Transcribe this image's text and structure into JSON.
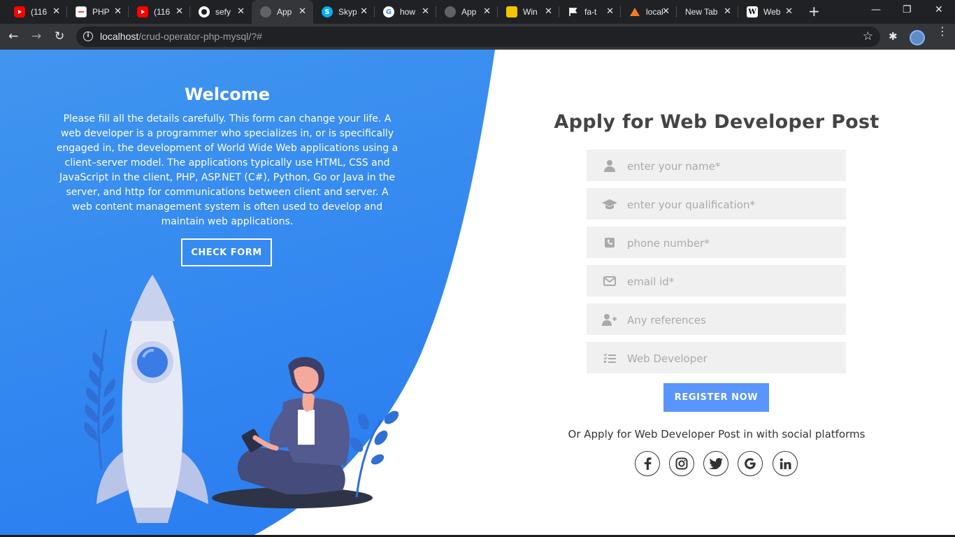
{
  "browser": {
    "tabs": [
      {
        "title": "(116",
        "favicon": "youtube-icon",
        "color": "#ff0000"
      },
      {
        "title": "PHP",
        "favicon": "php-icon",
        "color": "#ffffff"
      },
      {
        "title": "(116",
        "favicon": "youtube-icon",
        "color": "#ff0000"
      },
      {
        "title": "sefy",
        "favicon": "github-icon",
        "color": "#ffffff"
      },
      {
        "title": "App",
        "favicon": "globe-icon",
        "color": "#9aa0a6"
      },
      {
        "title": "Skyp",
        "favicon": "skype-icon",
        "color": "#00aff0"
      },
      {
        "title": "how",
        "favicon": "google-icon",
        "color": "#ffffff"
      },
      {
        "title": "App",
        "favicon": "globe-icon",
        "color": "#9aa0a6"
      },
      {
        "title": "Win",
        "favicon": "windows-icon",
        "color": "#f5c400"
      },
      {
        "title": "fa-t",
        "favicon": "flag-icon",
        "color": "#ffffff"
      },
      {
        "title": "local",
        "favicon": "xampp-icon",
        "color": "#fb7a24"
      },
      {
        "title": "New Tab",
        "favicon": "",
        "color": ""
      },
      {
        "title": "Web",
        "favicon": "wikipedia-icon",
        "color": "#ffffff"
      }
    ],
    "active_tab_index": 4,
    "url_host": "localhost",
    "url_path": "/crud-operator-php-mysql/?#"
  },
  "left": {
    "title": "Welcome",
    "text": "Please fill all the details carefully. This form can change your life. A web developer is a programmer who specializes in, or is specifically engaged in, the development of World Wide Web applications using a client–server model. The applications typically use HTML, CSS and JavaScript in the client, PHP, ASP.NET (C#), Python, Go or Java in the server, and http for communications between client and server. A web content management system is often used to develop and maintain web applications.",
    "button": "CHECK FORM"
  },
  "form": {
    "title": "Apply for Web Developer Post",
    "fields": [
      {
        "icon": "user-icon",
        "placeholder": "enter your name*"
      },
      {
        "icon": "graduation-cap-icon",
        "placeholder": "enter your qualification*"
      },
      {
        "icon": "phone-icon",
        "placeholder": "phone number*"
      },
      {
        "icon": "envelope-icon",
        "placeholder": "email id*"
      },
      {
        "icon": "user-plus-icon",
        "placeholder": "Any references"
      },
      {
        "icon": "list-icon",
        "placeholder": "Web Developer"
      }
    ],
    "register_button": "REGISTER NOW",
    "social_text": "Or Apply for Web Developer Post in with social platforms",
    "social": [
      {
        "icon": "facebook-icon",
        "glyph": "f"
      },
      {
        "icon": "instagram-icon",
        "glyph": ""
      },
      {
        "icon": "twitter-icon",
        "glyph": ""
      },
      {
        "icon": "google-icon",
        "glyph": "G"
      },
      {
        "icon": "linkedin-icon",
        "glyph": "in"
      }
    ]
  },
  "colors": {
    "accent": "#5995fd",
    "blue_bg": "#3b8ff0",
    "browser_dark": "#202124"
  }
}
